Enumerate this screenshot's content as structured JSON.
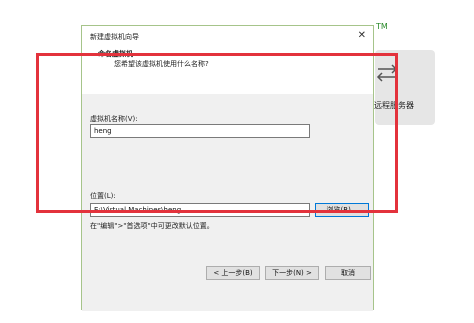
{
  "dialog": {
    "title": "新建虚拟机向导",
    "close_icon": "✕",
    "header_title": "命名虚拟机",
    "header_subtitle": "您希望该虚拟机使用什么名称?"
  },
  "form": {
    "name_label": "虚拟机名称(V):",
    "name_value": "heng",
    "location_label": "位置(L):",
    "location_value": "E:\\Virtual Machines\\heng",
    "browse_label": "浏览(R)...",
    "hint": "在\"编辑\">\"首选项\"中可更改默认位置。"
  },
  "footer": {
    "back_label": "< 上一步(B)",
    "next_label": "下一步(N) >",
    "cancel_label": "取消"
  },
  "background": {
    "tm": "TM",
    "remote_server_label": "远程服务器"
  },
  "colors": {
    "annotation_box": "#e3323c",
    "accent": "#0078d7"
  }
}
